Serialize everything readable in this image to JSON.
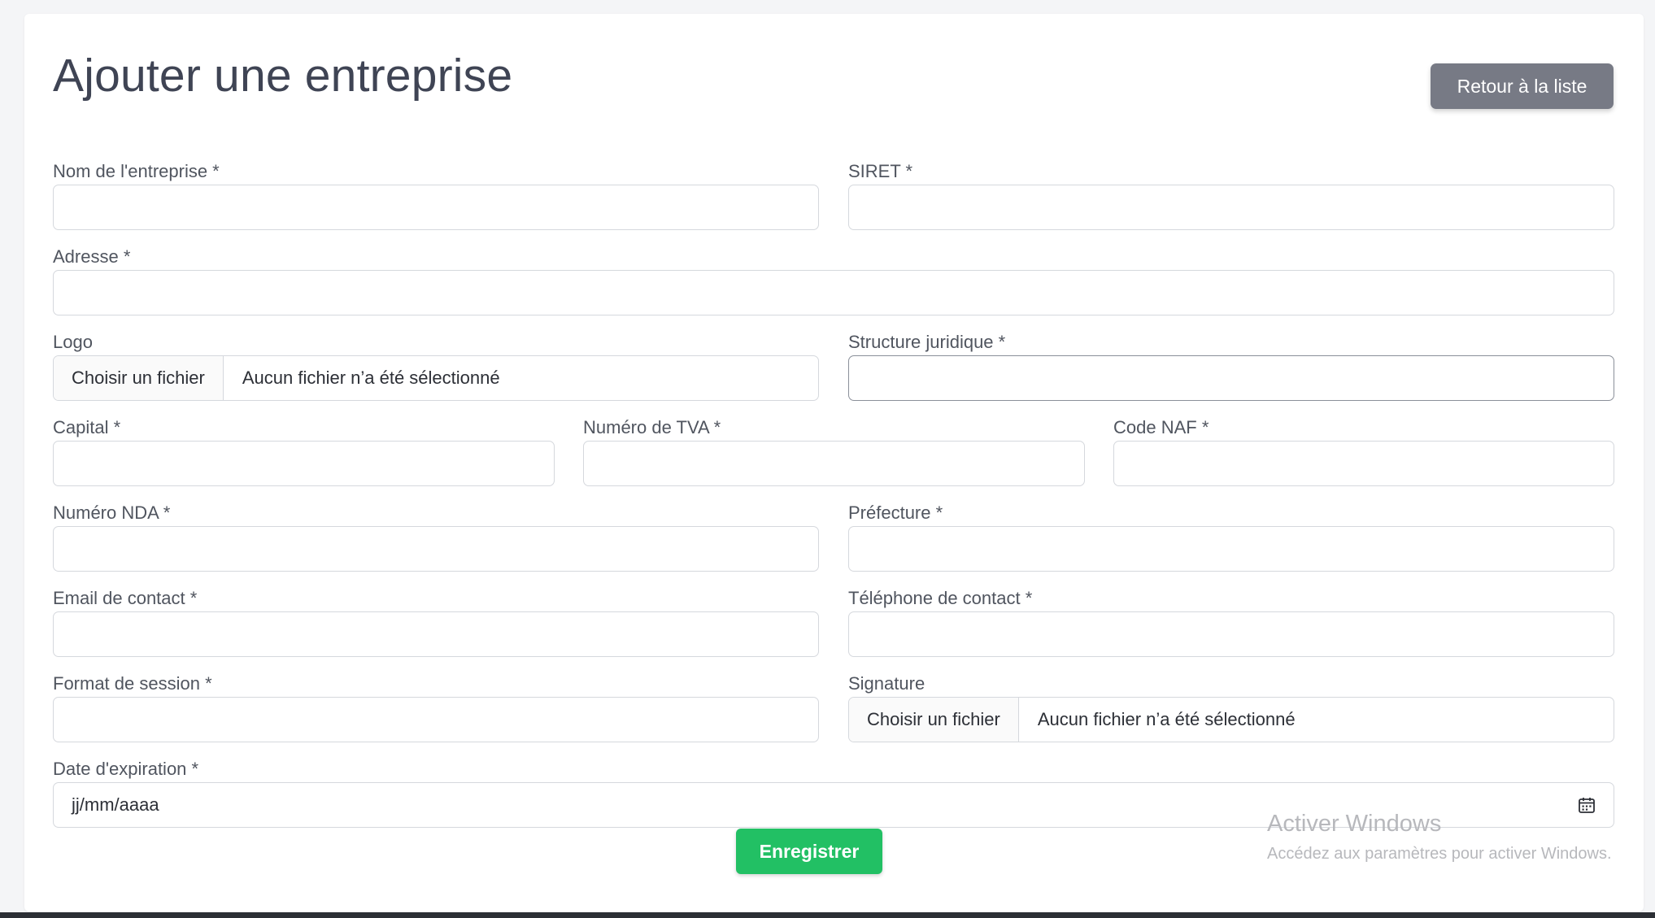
{
  "header": {
    "title": "Ajouter une entreprise",
    "back_label": "Retour à la liste"
  },
  "fields": {
    "company_name": {
      "label": "Nom de l'entreprise *",
      "value": ""
    },
    "siret": {
      "label": "SIRET *",
      "value": ""
    },
    "address": {
      "label": "Adresse *",
      "value": ""
    },
    "logo": {
      "label": "Logo",
      "button": "Choisir un fichier",
      "status": "Aucun fichier n’a été sélectionné"
    },
    "legal_structure": {
      "label": "Structure juridique *",
      "value": ""
    },
    "capital": {
      "label": "Capital *",
      "value": ""
    },
    "vat_number": {
      "label": "Numéro de TVA *",
      "value": ""
    },
    "naf_code": {
      "label": "Code NAF *",
      "value": ""
    },
    "nda_number": {
      "label": "Numéro NDA *",
      "value": ""
    },
    "prefecture": {
      "label": "Préfecture *",
      "value": ""
    },
    "contact_email": {
      "label": "Email de contact *",
      "value": ""
    },
    "contact_phone": {
      "label": "Téléphone de contact *",
      "value": ""
    },
    "session_format": {
      "label": "Format de session *",
      "value": ""
    },
    "signature": {
      "label": "Signature",
      "button": "Choisir un fichier",
      "status": "Aucun fichier n’a été sélectionné"
    },
    "expiration_date": {
      "label": "Date d'expiration *",
      "placeholder": "jj/mm/aaaa",
      "icon": "calendar-icon"
    }
  },
  "actions": {
    "save_label": "Enregistrer"
  },
  "watermark": {
    "title": "Activer Windows",
    "subtitle": "Accédez aux paramètres pour activer Windows."
  },
  "colors": {
    "save_button": "#22c064",
    "back_button": "#777a85",
    "title_text": "#3f4454"
  }
}
